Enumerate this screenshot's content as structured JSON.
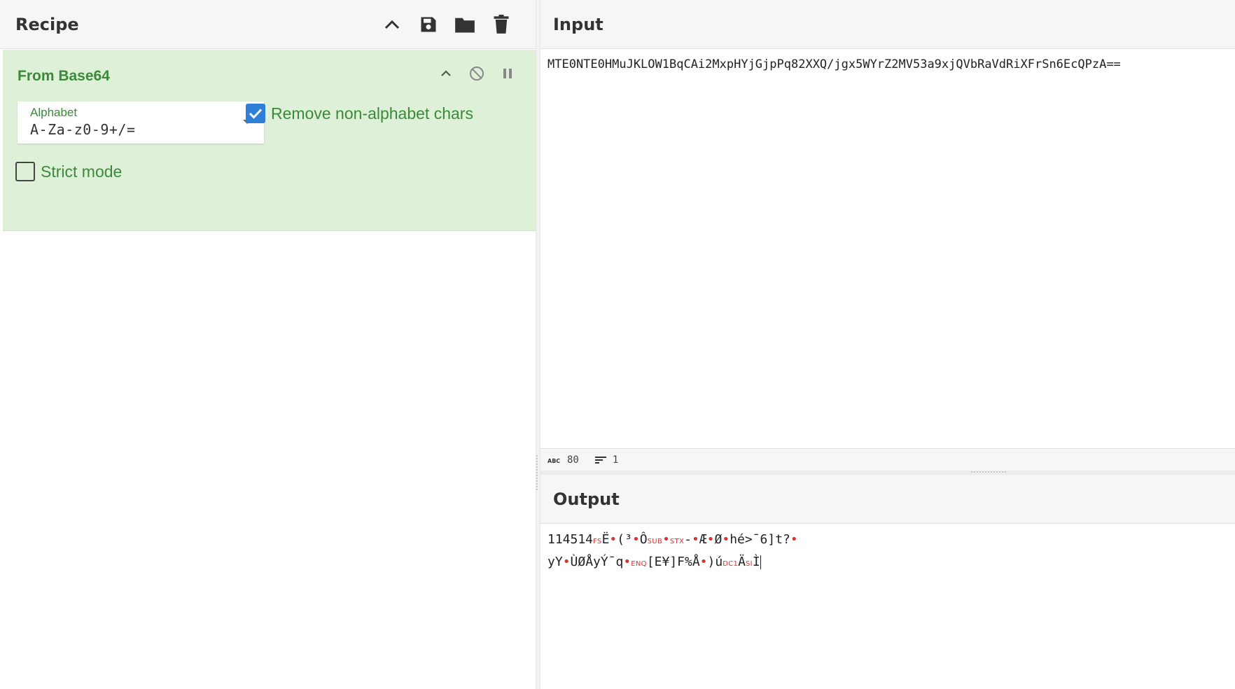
{
  "recipe": {
    "title": "Recipe",
    "icons": [
      "chevron-up-icon",
      "save-icon",
      "folder-icon",
      "trash-icon"
    ],
    "operation": {
      "title": "From Base64",
      "alphabet_label": "Alphabet",
      "alphabet_value": "A-Za-z0-9+/=",
      "remove_non_alphabet_label": "Remove non-alphabet chars",
      "remove_non_alphabet_checked": true,
      "strict_mode_label": "Strict mode",
      "strict_mode_checked": false
    }
  },
  "input": {
    "title": "Input",
    "text": "MTE0NTE0HMuJKLOW1BqCAi2MxpHYjGjpPq82XXQ/jgx5WYrZ2MV53a9xjQVbRaVdRiXFrSn6EcQPzA==",
    "char_count": "80",
    "line_count": "1"
  },
  "output": {
    "title": "Output",
    "line1": [
      {
        "t": "114514",
        "k": "txt"
      },
      {
        "t": "FS",
        "k": "ctrl"
      },
      {
        "t": "Ë",
        "k": "txt"
      },
      {
        "t": "•",
        "k": "dot"
      },
      {
        "t": "(³",
        "k": "txt"
      },
      {
        "t": "•",
        "k": "dot"
      },
      {
        "t": "Ô",
        "k": "txt"
      },
      {
        "t": "SUB",
        "k": "ctrl"
      },
      {
        "t": "•",
        "k": "dot"
      },
      {
        "t": "STX",
        "k": "ctrl"
      },
      {
        "t": "-",
        "k": "txt"
      },
      {
        "t": "•",
        "k": "dot"
      },
      {
        "t": "Æ",
        "k": "txt"
      },
      {
        "t": "•",
        "k": "dot"
      },
      {
        "t": "Ø",
        "k": "txt"
      },
      {
        "t": "•",
        "k": "dot"
      },
      {
        "t": "hé>¯6]t?",
        "k": "txt"
      },
      {
        "t": "•",
        "k": "dot"
      }
    ],
    "line2": [
      {
        "t": "yY",
        "k": "txt"
      },
      {
        "t": "•",
        "k": "dot"
      },
      {
        "t": "ÙØÅyÝ¯q",
        "k": "txt"
      },
      {
        "t": "•",
        "k": "dot"
      },
      {
        "t": "ENQ",
        "k": "ctrl"
      },
      {
        "t": "[E¥]F%Å",
        "k": "txt"
      },
      {
        "t": "•",
        "k": "dot"
      },
      {
        "t": ")ú",
        "k": "txt"
      },
      {
        "t": "DC1",
        "k": "ctrl"
      },
      {
        "t": "Ä",
        "k": "txt"
      },
      {
        "t": "SI",
        "k": "ctrl"
      },
      {
        "t": "Ì",
        "k": "txt"
      }
    ]
  }
}
